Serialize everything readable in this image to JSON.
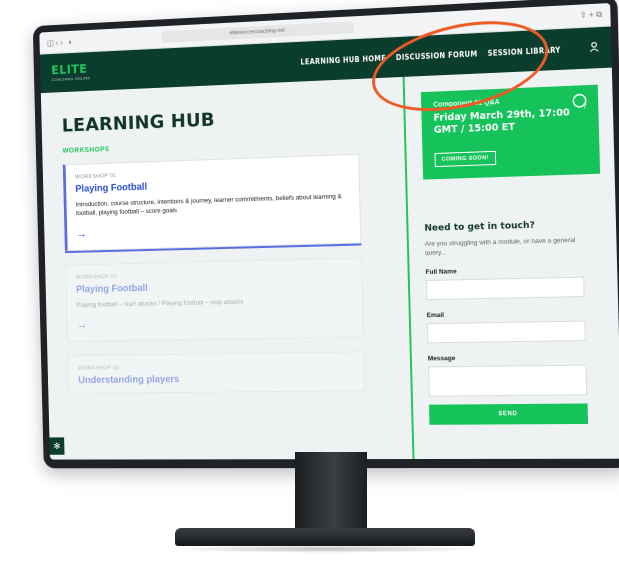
{
  "browser": {
    "url": "elitesoccercoaching.net",
    "nav_controls": "◫ ‹ ›",
    "actions": "⇪ + ⧉"
  },
  "site": {
    "logo_mark": "ELITE",
    "logo_sub": "COACHING ONLINE",
    "nav": {
      "learning_hub_home": "LEARNING HUB HOME",
      "discussion_forum": "DISCUSSION FORUM",
      "session_library": "SESSION LIBRARY"
    },
    "user_icon": "user-icon"
  },
  "main": {
    "title": "LEARNING HUB",
    "workshops_label": "WORKSHOPS",
    "workshops": [
      {
        "number": "WORKSHOP 01",
        "title": "Playing Football",
        "description": "Introduction, course structure, intentions & journey, learner commitments, beliefs about learning & football, playing football – score goals",
        "arrow": "→"
      },
      {
        "number": "WORKSHOP 02",
        "title": "Playing Football",
        "description": "Playing football – start attacks / Playing football – stop attacks",
        "arrow": "→"
      },
      {
        "number": "WORKSHOP 03",
        "title": "Understanding players",
        "description": "",
        "arrow": ""
      }
    ]
  },
  "sidebar": {
    "promo": {
      "label": "Component 01 Q&A",
      "date": "Friday March 29th, 17:00 GMT / 15:00 ET",
      "button": "COMING SOON!"
    },
    "contact": {
      "title": "Need to get in touch?",
      "subtitle": "Are you struggling with a module, or have a general query...",
      "full_name_label": "Full Name",
      "email_label": "Email",
      "message_label": "Message",
      "send_label": "SEND"
    }
  },
  "colors": {
    "nav_bg": "#0a3d2e",
    "accent_green": "#16c25a",
    "link_blue": "#2a4fd0",
    "annotation_orange": "#ee5a24"
  }
}
